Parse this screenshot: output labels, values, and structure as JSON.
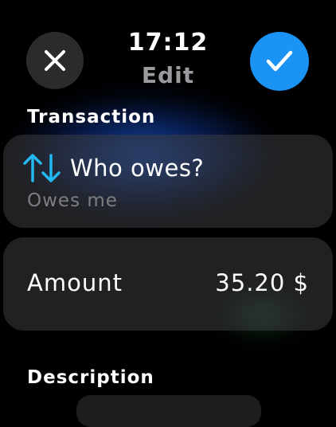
{
  "header": {
    "time": "17:12",
    "title": "Edit",
    "cancel_icon": "close-icon",
    "confirm_icon": "checkmark-icon",
    "confirm_color": "#1a93f5"
  },
  "transaction": {
    "section_label": "Transaction",
    "who": {
      "icon": "swap-vertical-arrows-icon",
      "icon_color": "#22b8f0",
      "title": "Who owes?",
      "value": "Owes me"
    },
    "amount": {
      "label": "Amount",
      "value": "35.20 $"
    }
  },
  "description": {
    "section_label": "Description"
  }
}
